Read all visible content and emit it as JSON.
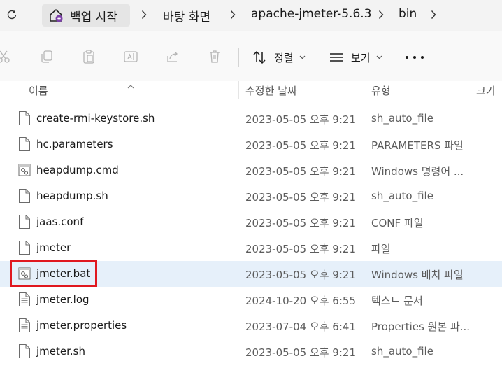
{
  "breadcrumb": {
    "home_label": "백업 시작",
    "items": [
      "바탕 화면",
      "apache-jmeter-5.6.3",
      "bin"
    ]
  },
  "toolbar": {
    "sort_label": "정렬",
    "view_label": "보기"
  },
  "columns": {
    "name": "이름",
    "modified": "수정한 날짜",
    "type": "유형",
    "size": "크기"
  },
  "files": [
    {
      "name": "create-rmi-keystore.sh",
      "modified": "2023-05-05 오후 9:21",
      "type": "sh_auto_file",
      "icon": "file-icon"
    },
    {
      "name": "hc.parameters",
      "modified": "2023-05-05 오후 9:21",
      "type": "PARAMETERS 파일",
      "icon": "file-icon"
    },
    {
      "name": "heapdump.cmd",
      "modified": "2023-05-05 오후 9:21",
      "type": "Windows 명령어 ...",
      "icon": "script-file-icon"
    },
    {
      "name": "heapdump.sh",
      "modified": "2023-05-05 오후 9:21",
      "type": "sh_auto_file",
      "icon": "file-icon"
    },
    {
      "name": "jaas.conf",
      "modified": "2023-05-05 오후 9:21",
      "type": "CONF 파일",
      "icon": "file-icon"
    },
    {
      "name": "jmeter",
      "modified": "2023-05-05 오후 9:21",
      "type": "파일",
      "icon": "file-icon"
    },
    {
      "name": "jmeter.bat",
      "modified": "2023-05-05 오후 9:21",
      "type": "Windows 배치 파일",
      "icon": "script-file-icon",
      "selected": true
    },
    {
      "name": "jmeter.log",
      "modified": "2024-10-20 오후 6:55",
      "type": "텍스트 문서",
      "icon": "text-file-icon"
    },
    {
      "name": "jmeter.properties",
      "modified": "2023-07-04 오후 6:41",
      "type": "Properties 원본 파...",
      "icon": "text-file-icon"
    },
    {
      "name": "jmeter.sh",
      "modified": "2023-05-05 오후 9:21",
      "type": "sh_auto_file",
      "icon": "file-icon"
    }
  ],
  "colors": {
    "selected_row": "#e6f0fa",
    "highlight_box": "#e0181f",
    "home_accent": "#7b3fa8"
  }
}
